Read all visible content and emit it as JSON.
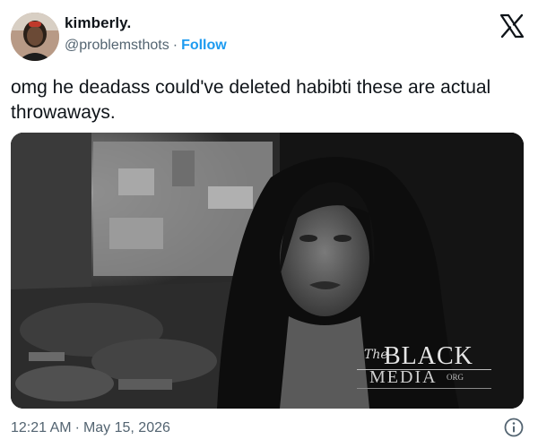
{
  "author": {
    "name": "kimberly.",
    "handle": "@problemsthots",
    "separator": "·",
    "follow_label": "Follow"
  },
  "tweet": {
    "text": "omg he deadass could've deleted habibti these are actual throwaways."
  },
  "media": {
    "description_icon": "photo",
    "watermark": {
      "the": "The",
      "black": "BLACK",
      "media": "MEDIA",
      "org": "ORG"
    }
  },
  "meta": {
    "time": "12:21 AM",
    "separator": "·",
    "date": "May 15, 2026"
  },
  "icons": {
    "brand": "x-logo-icon",
    "info": "info-icon"
  },
  "colors": {
    "link": "#1d9bf0",
    "secondary_text": "#536471",
    "primary_text": "#0f1419"
  }
}
